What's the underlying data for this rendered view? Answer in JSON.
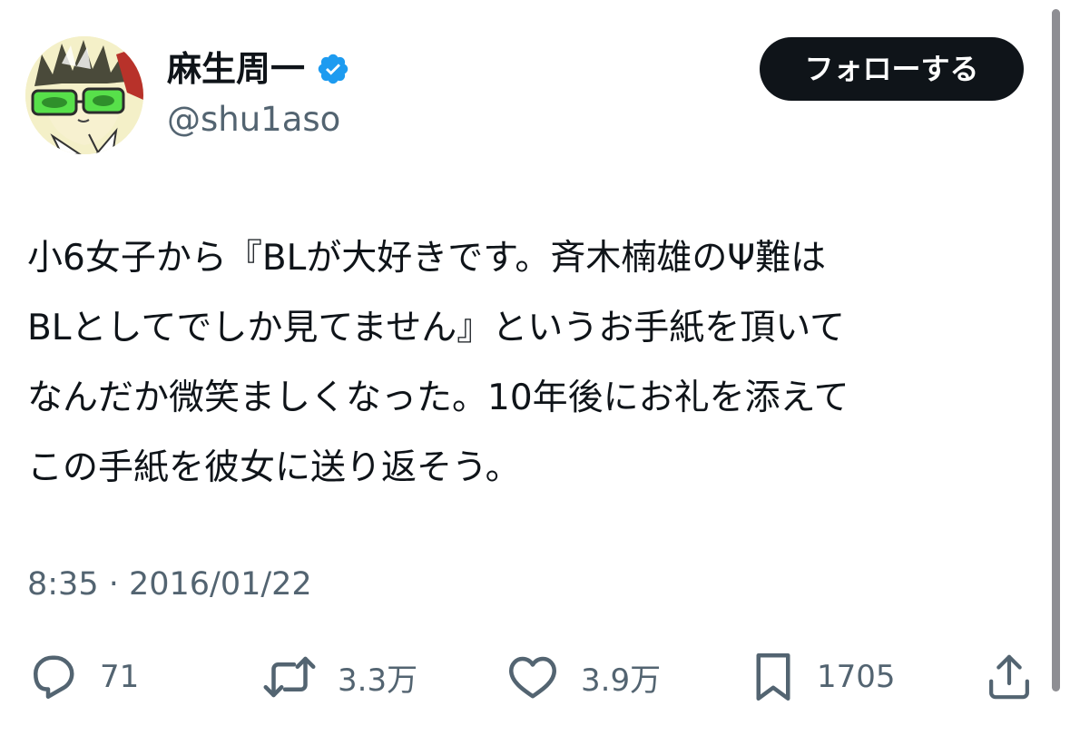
{
  "profile": {
    "display_name": "麻生周一",
    "handle": "@shu1aso",
    "avatar_icon": "avatar-image",
    "verified_icon": "verified-badge-icon",
    "verified_color": "#1d9bf0"
  },
  "follow_button": {
    "label": "フォローする"
  },
  "tweet": {
    "lines": [
      "小6女子から『BLが大好きです。斉木楠雄のΨ難は",
      "BLとしてでしか見てません』というお手紙を頂いて",
      "なんだか微笑ましくなった。10年後にお礼を添えて",
      "この手紙を彼女に送り返そう。"
    ],
    "timestamp": "8:35 · 2016/01/22"
  },
  "actions": {
    "reply": {
      "icon": "reply-icon",
      "count": "71"
    },
    "retweet": {
      "icon": "retweet-icon",
      "count": "3.3万"
    },
    "like": {
      "icon": "like-icon",
      "count": "3.9万"
    },
    "bookmark": {
      "icon": "bookmark-icon",
      "count": "1705"
    },
    "share": {
      "icon": "share-icon"
    }
  },
  "colors": {
    "text_primary": "#0f1419",
    "text_secondary": "#536471",
    "button_bg": "#0f1419",
    "button_text": "#ffffff"
  }
}
